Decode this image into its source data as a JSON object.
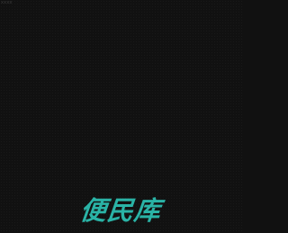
{
  "corner_text": "xxxx",
  "brand": {
    "label": "便民库",
    "color": "#2ab3a6"
  },
  "background_color": "#111111"
}
